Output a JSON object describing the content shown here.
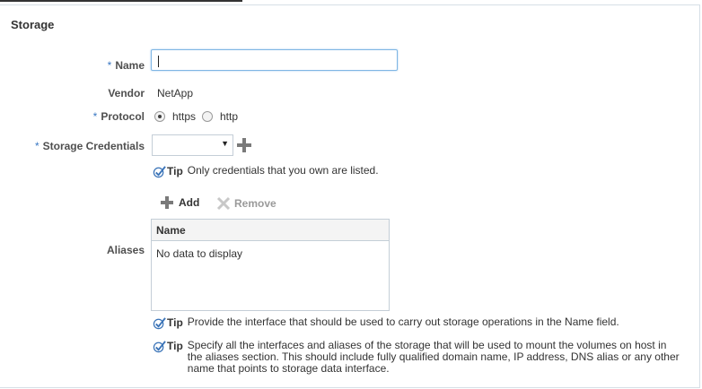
{
  "section": {
    "title": "Storage"
  },
  "form": {
    "name": {
      "label": "Name",
      "value": "",
      "required": true
    },
    "vendor": {
      "label": "Vendor",
      "value": "NetApp"
    },
    "protocol": {
      "label": "Protocol",
      "required": true,
      "options": [
        {
          "label": "https",
          "selected": true
        },
        {
          "label": "http",
          "selected": false
        }
      ]
    },
    "credentials": {
      "label": "Storage Credentials",
      "value": "",
      "required": true,
      "add_icon": "plus-icon"
    },
    "aliases": {
      "label": "Aliases"
    }
  },
  "tips": {
    "credentials": {
      "label": "Tip",
      "text": "Only credentials that you own are listed."
    },
    "name_field": {
      "label": "Tip",
      "text": "Provide the interface that should be used to carry out storage operations in the Name field."
    },
    "aliases": {
      "label": "Tip",
      "text": "Specify all the interfaces and aliases of the storage that will be used to mount the volumes on host in the aliases section. This should include fully qualified domain name, IP address, DNS alias or any other name that points to storage data interface."
    }
  },
  "aliases_toolbar": {
    "add_label": "Add",
    "remove_label": "Remove"
  },
  "aliases_table": {
    "columns": [
      "Name"
    ],
    "empty_text": "No data to display"
  },
  "colors": {
    "required_asterisk": "#3a78c3",
    "tip_check": "#3b74b8",
    "input_focus": "#7fb6e4"
  }
}
